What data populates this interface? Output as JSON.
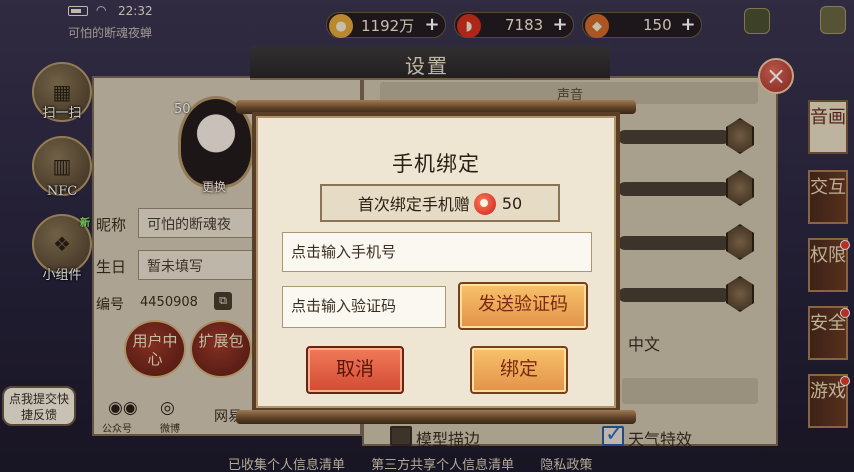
{
  "status": {
    "time": "22:32",
    "player_name": "可怕的断魂夜蝉"
  },
  "resources": [
    {
      "name": "coins",
      "value": "1192万",
      "icon": "coin-icon",
      "color": "#e2a83a"
    },
    {
      "name": "magatama",
      "value": "7183",
      "icon": "magatama-icon",
      "color": "#d2301e"
    },
    {
      "name": "stamina",
      "value": "150",
      "icon": "stamina-icon",
      "color": "#d06a2a"
    }
  ],
  "side_buttons": {
    "scan": "扫一扫",
    "nfc": "NFC",
    "widget": "小组件",
    "new_tag": "新"
  },
  "settings": {
    "title": "设置",
    "close_icon": "×",
    "sound_section": "声音",
    "avatar_level": "50",
    "avatar_change": "更换",
    "nickname_label": "昵称",
    "nickname_value": "可怕的断魂夜",
    "birthday_label": "生日",
    "birthday_value": "暂未填写",
    "id_label": "编号",
    "id_value": "4450908",
    "user_center": "用户中心",
    "expansion_pack": "扩展包",
    "official_account": "公众号",
    "weibo": "微博",
    "network_label": "网易",
    "language_value": "中文",
    "model_outline": "模型描边",
    "weather_effects": "天气特效",
    "feedback": "点我提交快捷反馈"
  },
  "bottom_links": [
    "已收集个人信息清单",
    "第三方共享个人信息清单",
    "隐私政策"
  ],
  "tabs": [
    {
      "label": "音画",
      "active": true
    },
    {
      "label": "交互",
      "active": false
    },
    {
      "label": "权限",
      "active": false
    },
    {
      "label": "安全",
      "active": false
    },
    {
      "label": "游戏",
      "active": false
    }
  ],
  "modal": {
    "title": "手机绑定",
    "bonus_text": "首次绑定手机赠",
    "bonus_amount": "50",
    "phone_placeholder": "点击输入手机号",
    "code_placeholder": "点击输入验证码",
    "send_code": "发送验证码",
    "cancel": "取消",
    "confirm": "绑定"
  }
}
